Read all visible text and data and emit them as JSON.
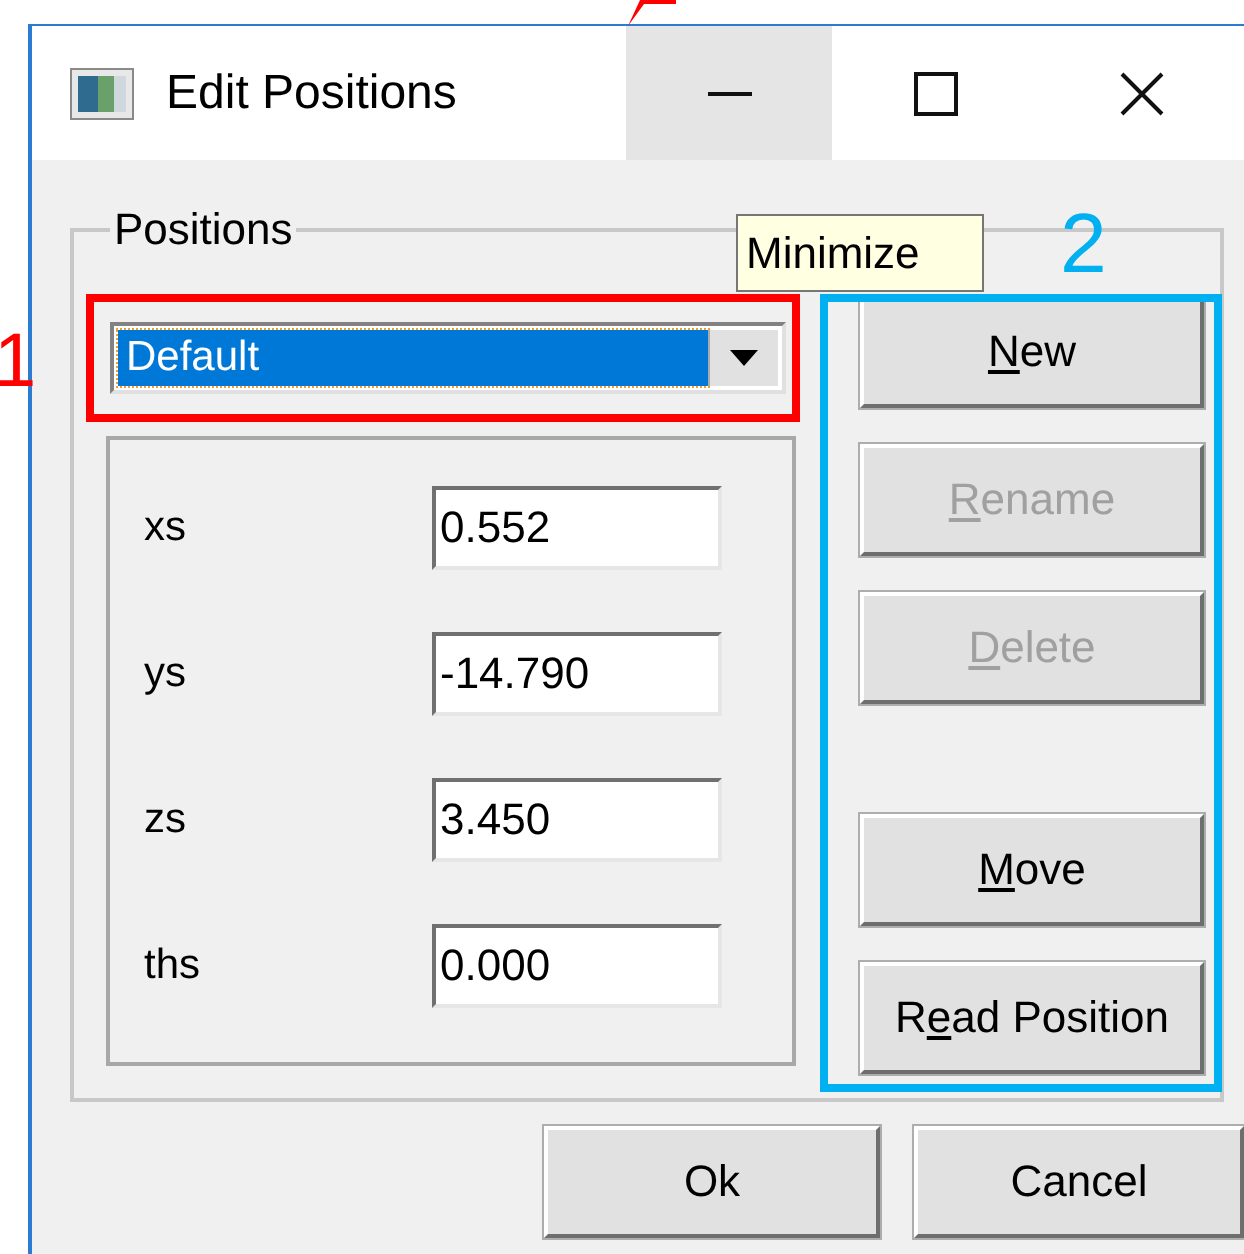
{
  "window": {
    "title": "Edit Positions"
  },
  "caption_buttons": [
    {
      "kind": "minimize",
      "hovered": true
    },
    {
      "kind": "maximize",
      "hovered": false
    },
    {
      "kind": "close",
      "hovered": false
    }
  ],
  "tooltip": {
    "text": "Minimize"
  },
  "group": {
    "label": "Positions",
    "dropdown": {
      "value": "Default",
      "selected": true
    },
    "fields": [
      {
        "label": "xs",
        "value": "0.552"
      },
      {
        "label": "ys",
        "value": "-14.790"
      },
      {
        "label": "zs",
        "value": "3.450"
      },
      {
        "label": "ths",
        "value": "0.000"
      }
    ],
    "buttons": [
      {
        "key": "N",
        "after": "ew",
        "disabled": false
      },
      {
        "key": "R",
        "after": "ename",
        "disabled": true
      },
      {
        "key": "D",
        "after": "elete",
        "disabled": true
      },
      {
        "key": "M",
        "after": "ove",
        "disabled": false
      },
      {
        "before": "R",
        "key": "e",
        "after": "ad Position",
        "disabled": false
      }
    ]
  },
  "footer_buttons": [
    {
      "label": "Ok"
    },
    {
      "label": "Cancel"
    }
  ],
  "annotations": [
    {
      "number": "1",
      "color": "#ff0000"
    },
    {
      "number": "2",
      "color": "#00b0f0"
    }
  ]
}
